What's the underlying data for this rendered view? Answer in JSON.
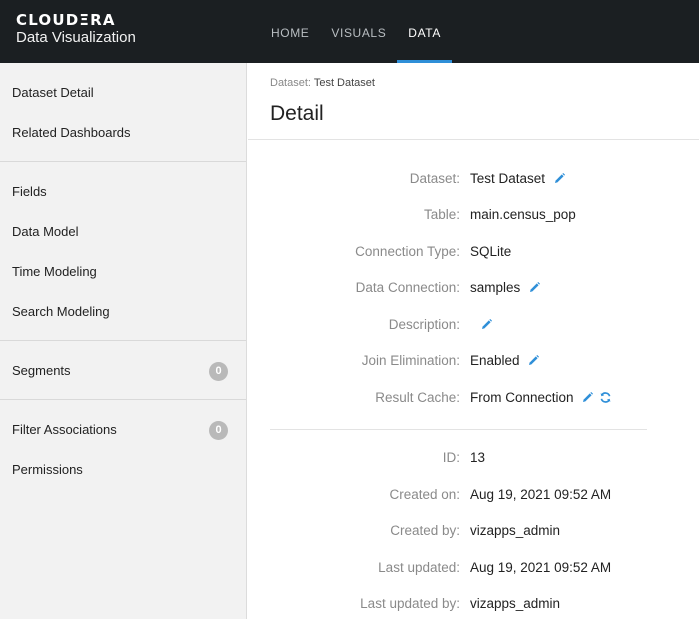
{
  "brand": {
    "logo": "CLOUDΞRA",
    "subtitle": "Data Visualization"
  },
  "nav": [
    {
      "label": "HOME"
    },
    {
      "label": "VISUALS"
    },
    {
      "label": "DATA"
    }
  ],
  "nav_active": "DATA",
  "sidebar": {
    "groups": [
      [
        {
          "label": "Dataset Detail"
        },
        {
          "label": "Related Dashboards"
        }
      ],
      [
        {
          "label": "Fields"
        },
        {
          "label": "Data Model"
        },
        {
          "label": "Time Modeling"
        },
        {
          "label": "Search Modeling"
        }
      ],
      [
        {
          "label": "Segments",
          "badge": "0"
        }
      ],
      [
        {
          "label": "Filter Associations",
          "badge": "0"
        },
        {
          "label": "Permissions"
        }
      ]
    ]
  },
  "breadcrumb": {
    "prefix": "Dataset:",
    "value": "Test Dataset"
  },
  "page_title": "Detail",
  "details": [
    {
      "label": "Dataset:",
      "value": "Test Dataset",
      "icons": [
        "pencil-icon"
      ]
    },
    {
      "label": "Table:",
      "value": "main.census_pop",
      "icons": []
    },
    {
      "label": "Connection Type:",
      "value": "SQLite",
      "icons": []
    },
    {
      "label": "Data Connection:",
      "value": "samples",
      "icons": [
        "pencil-icon"
      ]
    },
    {
      "label": "Description:",
      "value": "",
      "icons": [
        "pencil-icon"
      ]
    },
    {
      "label": "Join Elimination:",
      "value": "Enabled",
      "icons": [
        "pencil-icon"
      ]
    },
    {
      "label": "Result Cache:",
      "value": "From Connection",
      "icons": [
        "pencil-icon",
        "refresh-icon"
      ]
    }
  ],
  "metadata": [
    {
      "label": "ID:",
      "value": "13"
    },
    {
      "label": "Created on:",
      "value": "Aug 19, 2021 09:52 AM"
    },
    {
      "label": "Created by:",
      "value": "vizapps_admin"
    },
    {
      "label": "Last updated:",
      "value": "Aug 19, 2021 09:52 AM"
    },
    {
      "label": "Last updated by:",
      "value": "vizapps_admin"
    }
  ],
  "colors": {
    "topbar": "#1b1f22",
    "accent": "#2f8fd8",
    "sidebar": "#f2f2f2",
    "label": "#8a8a8a"
  }
}
